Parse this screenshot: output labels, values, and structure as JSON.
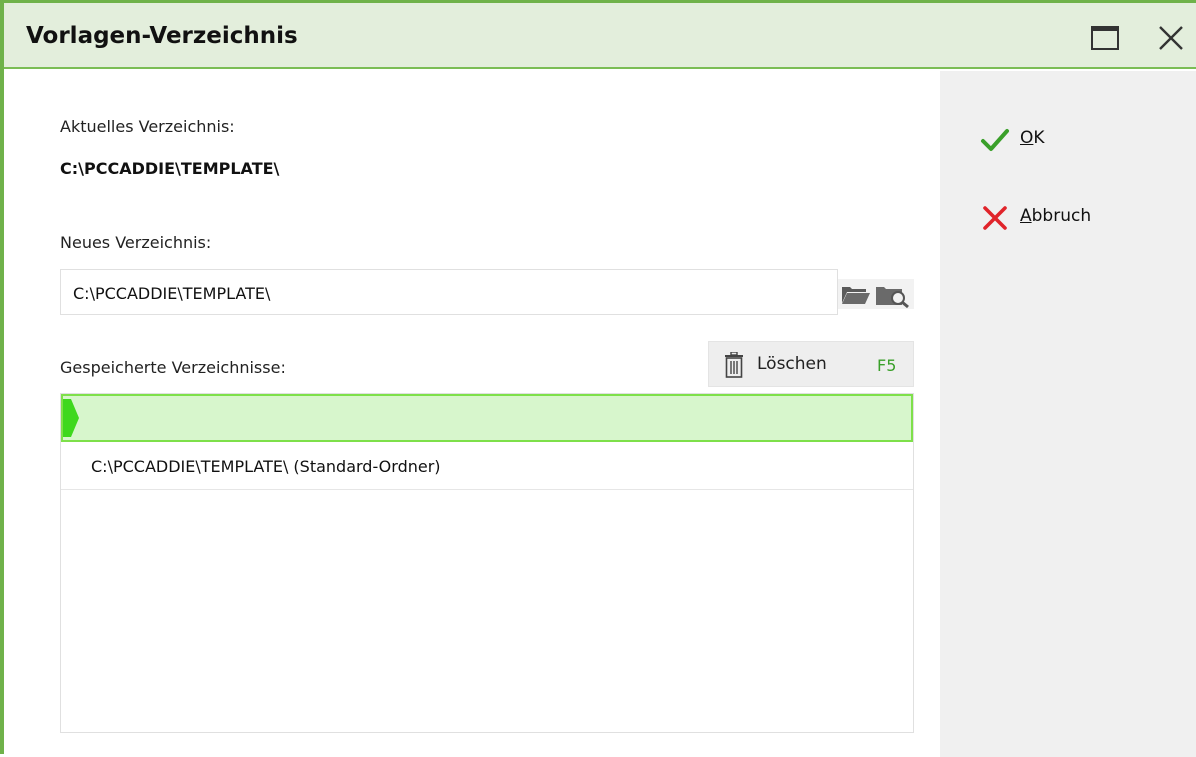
{
  "window": {
    "title": "Vorlagen-Verzeichnis",
    "accent_color": "#6fb24a",
    "maximize_icon": "maximize-icon",
    "close_icon": "close-icon"
  },
  "current": {
    "label": "Aktuelles Verzeichnis:",
    "value": "C:\\PCCADDIE\\TEMPLATE\\"
  },
  "new_dir": {
    "label": "Neues Verzeichnis:",
    "value": "C:\\PCCADDIE\\TEMPLATE\\",
    "open_folder_icon": "open-folder-icon",
    "browse_folder_icon": "browse-folder-icon"
  },
  "saved": {
    "label": "Gespeicherte Verzeichnisse:",
    "delete_label": "Löschen",
    "delete_key": "F5",
    "delete_icon": "trash-icon",
    "items": [
      {
        "label": "C:\\PCCADDIE\\TEMPLATE\\ (Standard-Ordner)"
      }
    ],
    "new_row_color": "#d7f6cc"
  },
  "actions": {
    "ok_first": "O",
    "ok_rest": "K",
    "cancel_first": "A",
    "cancel_rest": "bbruch",
    "ok_color": "#3aa02a",
    "cancel_color": "#e0242a"
  }
}
